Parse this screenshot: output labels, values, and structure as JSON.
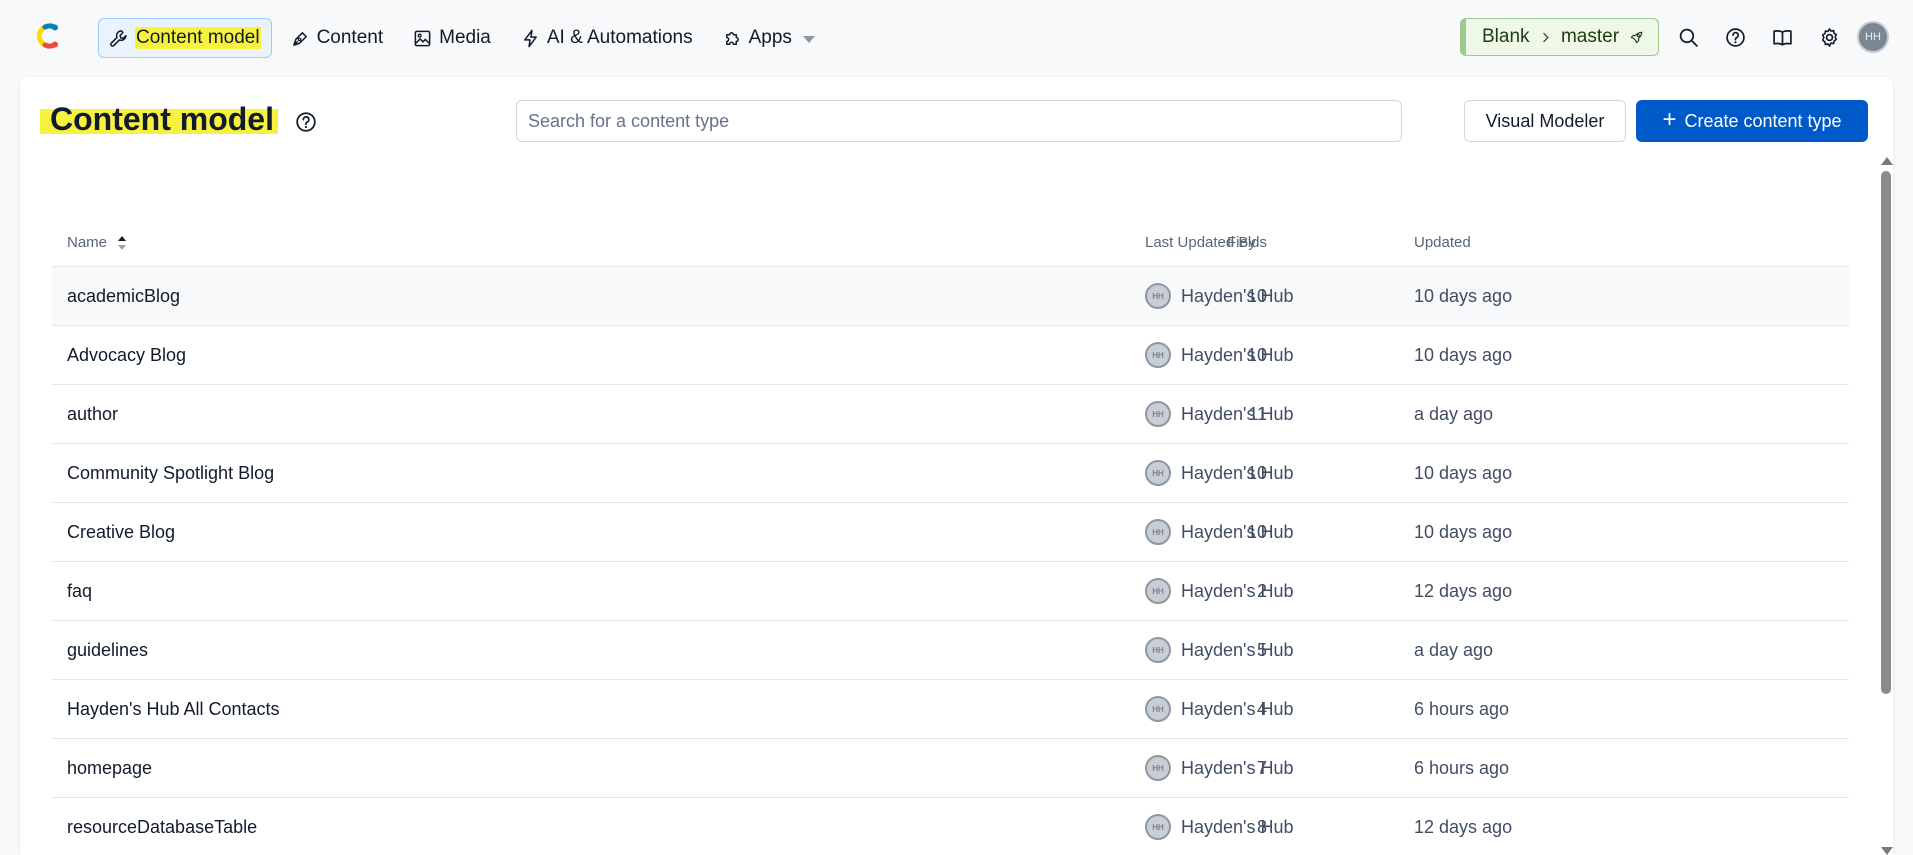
{
  "nav": {
    "items": [
      {
        "label": "Content model",
        "icon": "wrench-icon",
        "active": true
      },
      {
        "label": "Content",
        "icon": "pen-nib-icon",
        "active": false
      },
      {
        "label": "Media",
        "icon": "image-icon",
        "active": false
      },
      {
        "label": "AI & Automations",
        "icon": "lightning-icon",
        "active": false
      },
      {
        "label": "Apps",
        "icon": "puzzle-icon",
        "active": false
      }
    ],
    "environment": {
      "space": "Blank",
      "env": "master"
    },
    "user_initials": "HH"
  },
  "page": {
    "title": "Content model",
    "search_placeholder": "Search for a content type",
    "visual_modeler_label": "Visual Modeler",
    "create_label": "Create content type"
  },
  "table": {
    "columns": {
      "name": "Name",
      "fields": "Fields",
      "by": "Last Updated By",
      "updated": "Updated"
    },
    "rows": [
      {
        "name": "academicBlog",
        "fields": "10",
        "by": "Hayden's Hub",
        "updated": "10 days ago"
      },
      {
        "name": "Advocacy Blog",
        "fields": "10",
        "by": "Hayden's Hub",
        "updated": "10 days ago"
      },
      {
        "name": "author",
        "fields": "11",
        "by": "Hayden's Hub",
        "updated": "a day ago"
      },
      {
        "name": "Community Spotlight Blog",
        "fields": "10",
        "by": "Hayden's Hub",
        "updated": "10 days ago"
      },
      {
        "name": "Creative Blog",
        "fields": "10",
        "by": "Hayden's Hub",
        "updated": "10 days ago"
      },
      {
        "name": "faq",
        "fields": "2",
        "by": "Hayden's Hub",
        "updated": "12 days ago"
      },
      {
        "name": "guidelines",
        "fields": "5",
        "by": "Hayden's Hub",
        "updated": "a day ago"
      },
      {
        "name": "Hayden's Hub All Contacts",
        "fields": "4",
        "by": "Hayden's Hub",
        "updated": "6 hours ago"
      },
      {
        "name": "homepage",
        "fields": "7",
        "by": "Hayden's Hub",
        "updated": "6 hours ago"
      },
      {
        "name": "resourceDatabaseTable",
        "fields": "8",
        "by": "Hayden's Hub",
        "updated": "12 days ago"
      }
    ],
    "avatar_initials": "HH"
  },
  "colors": {
    "primary": "#0059c8",
    "highlight": "#f7f240",
    "env_green": "#9fc88e"
  }
}
